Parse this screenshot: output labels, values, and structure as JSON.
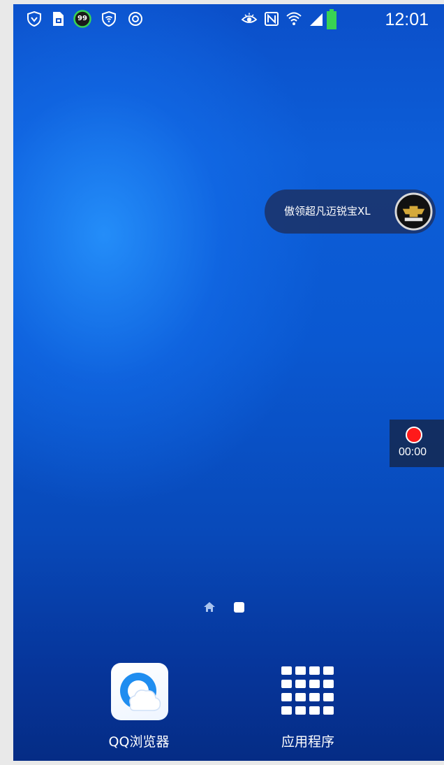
{
  "status_bar": {
    "left_icons": [
      "shield-vpn-icon",
      "sim-card-icon",
      "battery-saver-99-icon",
      "wifi-shield-icon",
      "settings-circle-icon"
    ],
    "right_icons": [
      "eye-icon",
      "nfc-icon",
      "wifi-icon",
      "signal-icon",
      "battery-icon"
    ],
    "saver_badge": "99",
    "time": "12:01"
  },
  "promo_pill": {
    "text": "傲领超凡迈锐宝XL",
    "logo_icon": "chevrolet-logo-icon"
  },
  "recorder": {
    "icon": "record-dot-icon",
    "time": "00:00",
    "dot_color": "#ff1a1a"
  },
  "page_indicator": {
    "home_icon": "home-page-icon",
    "current_page_icon": "page-dot-icon"
  },
  "dock": {
    "apps": [
      {
        "label": "QQ浏览器",
        "icon": "qq-browser-icon"
      },
      {
        "label": "应用程序",
        "icon": "app-drawer-grid-icon"
      }
    ]
  },
  "colors": {
    "wallpaper_top": "#0b4fc9",
    "wallpaper_bottom": "#052c85",
    "pill_bg": "#1c3060",
    "accent_red": "#ff1a1a"
  }
}
